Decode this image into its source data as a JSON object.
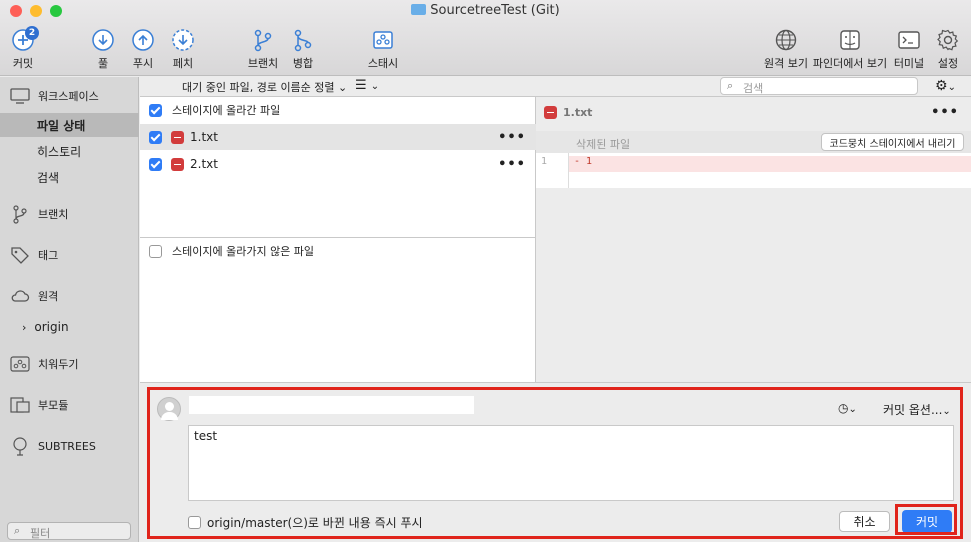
{
  "window": {
    "title": "SourcetreeTest (Git)"
  },
  "toolbar": {
    "commit": {
      "label": "커밋",
      "badge": "2",
      "icon": "commit-plus-icon"
    },
    "pull": {
      "label": "풀",
      "icon": "pull-arrow-down-icon"
    },
    "push": {
      "label": "푸시",
      "icon": "push-arrow-up-icon"
    },
    "fetch": {
      "label": "페치",
      "icon": "fetch-dashed-arrow-icon"
    },
    "branch": {
      "label": "브랜치",
      "icon": "branch-icon"
    },
    "merge": {
      "label": "병합",
      "icon": "merge-icon"
    },
    "stash": {
      "label": "스태시",
      "icon": "stash-icon"
    },
    "remote_view": {
      "label": "원격 보기",
      "icon": "globe-icon"
    },
    "show_in_finder": {
      "label": "파인더에서 보기",
      "icon": "finder-icon"
    },
    "terminal": {
      "label": "터미널",
      "icon": "terminal-icon"
    },
    "settings": {
      "label": "설정",
      "icon": "gear-icon"
    }
  },
  "subbar": {
    "sort_label": "대기 중인 파일, 경로 이름순 정렬",
    "search_placeholder": "검색"
  },
  "sidebar": {
    "workspace": "워크스페이스",
    "items": [
      {
        "label": "파일 상태",
        "selected": true
      },
      {
        "label": "히스토리",
        "selected": false
      },
      {
        "label": "검색",
        "selected": false
      }
    ],
    "branches": "브랜치",
    "tags": "태그",
    "remotes": "원격",
    "remote_origin": "origin",
    "stashes": "치워두기",
    "submodules": "부모듈",
    "subtrees": "SUBTREES",
    "filter_placeholder": "필터"
  },
  "files": {
    "staged_header": "스테이지에 올라간 파일",
    "staged": [
      {
        "name": "1.txt",
        "status": "removed"
      },
      {
        "name": "2.txt",
        "status": "removed"
      }
    ],
    "unstaged_header": "스테이지에 올라가지 않은 파일"
  },
  "diff": {
    "file": "1.txt",
    "hunk_label": "삭제된 파일",
    "unstage_button": "코드뭉치 스테이지에서 내리기",
    "line_number": "1",
    "line_text": "- 1"
  },
  "commit": {
    "message": "test",
    "options_label": "커밋 옵션...",
    "push_checkbox_label": "origin/master(으)로 바뀐 내용 즉시 푸시",
    "cancel_label": "취소",
    "commit_label": "커밋"
  },
  "colors": {
    "accent": "#2f7cf6",
    "removed": "#d23c3c",
    "highlight": "#e0241b",
    "deleted_line_bg": "#fbe3e3"
  }
}
